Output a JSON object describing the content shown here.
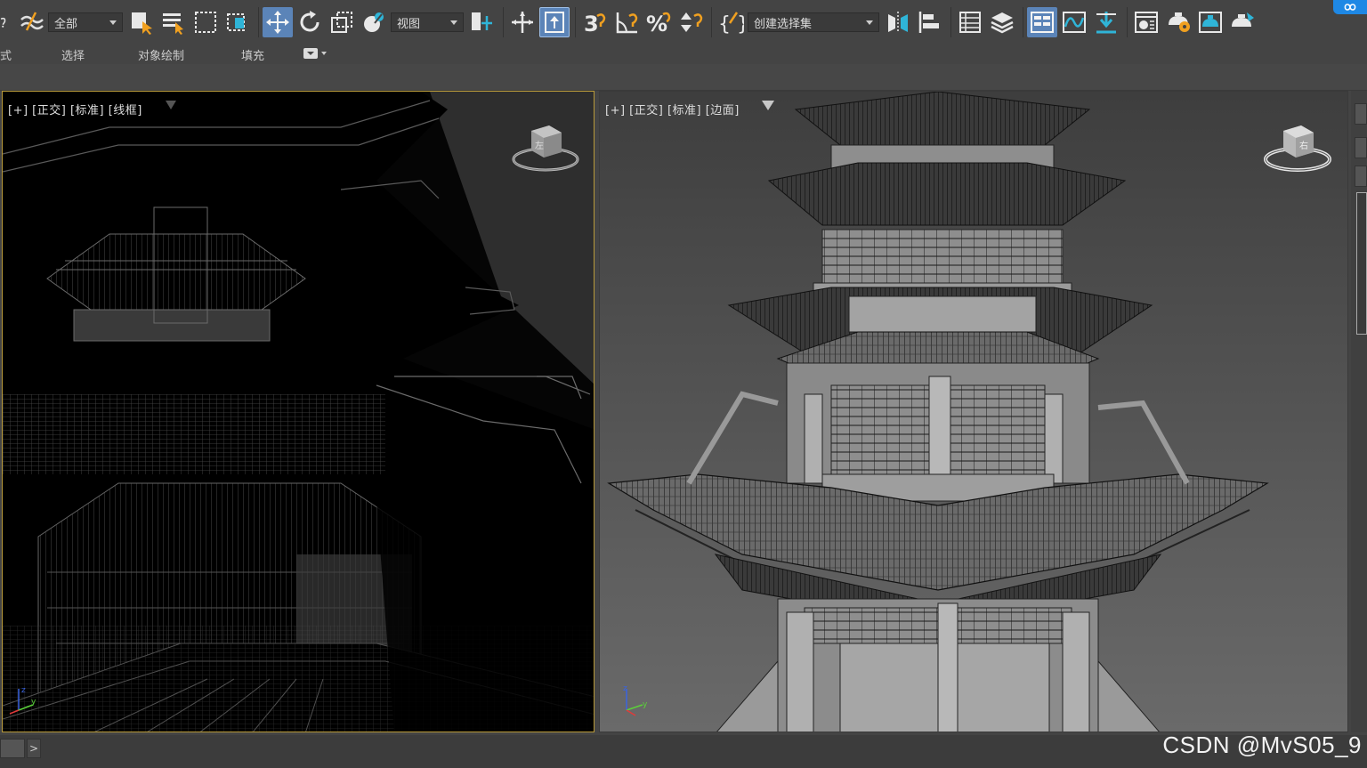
{
  "toolbar": {
    "selection_filter": "全部",
    "reference_coord": "视图",
    "named_selection": "创建选择集"
  },
  "ribbon": {
    "tabs": [
      "式",
      "选择",
      "对象绘制",
      "填充"
    ]
  },
  "viewports": {
    "left": {
      "label": "[+] [正交] [标准] [线框]",
      "cube_face": "左"
    },
    "right": {
      "label": "[+] [正交] [标准] [边面]",
      "cube_face": "右"
    }
  },
  "bottom": {
    "scroll_arrow": ">"
  },
  "watermark": "CSDN @MvS05_9",
  "colors": {
    "active_viewport_border": "#b89a3a",
    "active_tool": "#5b84b8",
    "background": "#444444"
  },
  "icons": {
    "toolbar": [
      "link-icon",
      "bind-spacewarp-icon",
      "select-object-icon",
      "select-by-name-icon",
      "rect-region-icon",
      "window-crossing-icon",
      "select-move-icon",
      "select-rotate-icon",
      "select-scale-icon",
      "place-icon",
      "use-pivot-icon",
      "select-manipulate-icon",
      "snap-3d-icon",
      "angle-snap-icon",
      "percent-snap-icon",
      "spinner-snap-icon",
      "edit-named-sets-icon",
      "mirror-icon",
      "align-icon",
      "scene-explorer-icon",
      "layer-explorer-icon",
      "toggle-ribbon-icon",
      "curve-editor-icon",
      "schematic-icon",
      "material-editor-icon",
      "render-setup-icon",
      "rendered-frame-icon",
      "render-production-icon"
    ]
  }
}
